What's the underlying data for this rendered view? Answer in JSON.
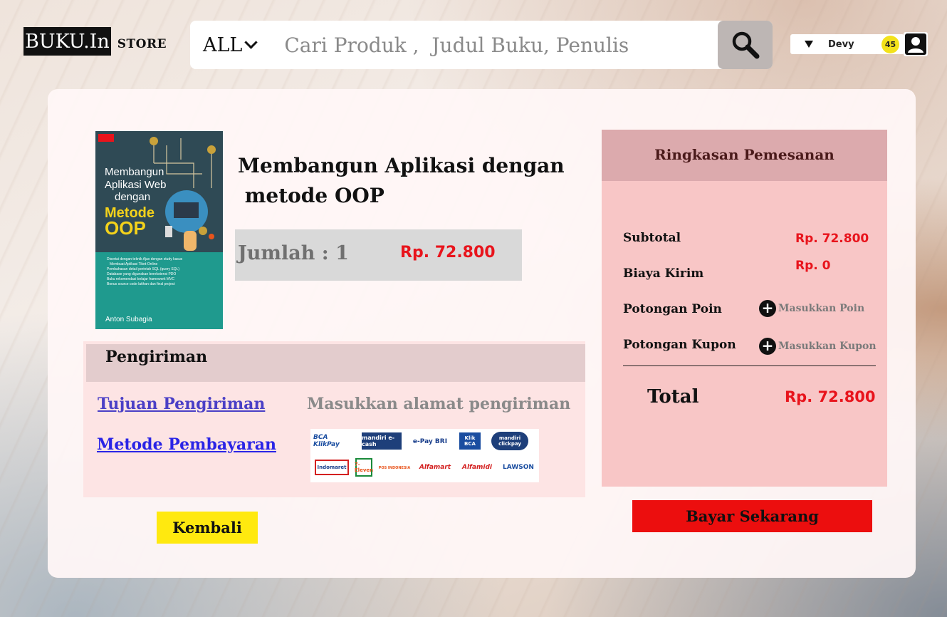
{
  "header": {
    "logo_main": "BUKU.In",
    "logo_sub": "STORE",
    "category": "ALL",
    "search_placeholder": "Cari Produk ,  Judul Buku, Penulis",
    "user_name": "Devy",
    "points_badge": "45"
  },
  "product": {
    "title_line1": "Membangun Aplikasi dengan",
    "title_line2": " metode OOP",
    "quantity_label": "Jumlah : 1",
    "price": "Rp. 72.800",
    "cover": {
      "line1": "Membangun",
      "line2": "Aplikasi Web",
      "line3": "dengan",
      "line4": "Metode",
      "line5": "OOP",
      "author": "Anton Subagia",
      "bullets": [
        "Disertai dengan teknik Ajax dengan study kasus",
        "Membuat Aplikasi Tiket-Online",
        "Pembahasan detail perintah SQL (query SQL)",
        "Database yang digunakan berekstensi PDO",
        "Buku rekomendasi belajar framework MVC",
        "Bonus source code latihan dan final project"
      ]
    }
  },
  "shipping": {
    "title": "Pengiriman",
    "destination_link": "Tujuan Pengiriman",
    "destination_placeholder": "Masukkan alamat pengiriman",
    "payment_link": "Metode Pembayaran",
    "payment_logos": [
      "BCA KlikPay",
      "mandiri e-cash",
      "e-Pay BRI",
      "Klik BCA",
      "mandiri clickpay",
      "Indomaret",
      "7-Eleven",
      "POS INDONESIA",
      "Alfamart",
      "Alfamidi",
      "LAWSON"
    ]
  },
  "summary": {
    "title": "Ringkasan Pemesanan",
    "subtotal_label": "Subtotal",
    "subtotal_value": "Rp. 72.800",
    "shipping_label": "Biaya Kirim",
    "shipping_value": "Rp. 0",
    "points_label": "Potongan Poin",
    "points_action": "Masukkan Poin",
    "coupon_label": "Potongan Kupon",
    "coupon_action": "Masukkan Kupon",
    "total_label": "Total",
    "total_value": "Rp. 72.800"
  },
  "buttons": {
    "back": "Kembali",
    "pay": "Bayar Sekarang"
  },
  "colors": {
    "price_red": "#e8141c",
    "pay_button": "#ec0e0e",
    "back_button": "#ffe90f",
    "summary_bg": "#f8c6c6",
    "link_blue": "#2a24e6"
  }
}
